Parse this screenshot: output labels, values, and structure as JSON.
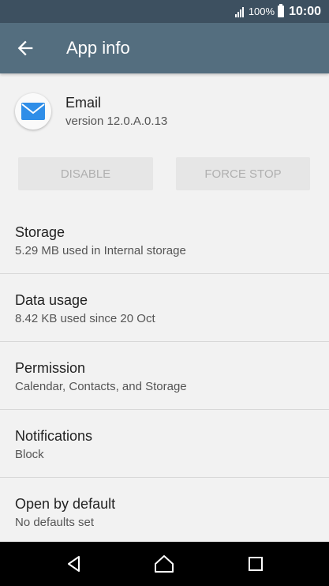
{
  "status_bar": {
    "battery_percent": "100%",
    "time": "10:00",
    "icons": [
      "signal-icon",
      "battery-icon"
    ]
  },
  "app_bar": {
    "back_icon": "arrow-back-icon",
    "title": "App info"
  },
  "app": {
    "icon": "mail-envelope-icon",
    "name": "Email",
    "version": "version 12.0.A.0.13"
  },
  "buttons": {
    "disable_label": "DISABLE",
    "force_stop_label": "FORCE STOP"
  },
  "settings": [
    {
      "title": "Storage",
      "subtitle": "5.29 MB used in Internal storage"
    },
    {
      "title": "Data usage",
      "subtitle": "8.42 KB used since 20 Oct"
    },
    {
      "title": "Permission",
      "subtitle": "Calendar, Contacts, and Storage"
    },
    {
      "title": "Notifications",
      "subtitle": "Block"
    },
    {
      "title": "Open by default",
      "subtitle": "No defaults set"
    }
  ],
  "nav_bar": {
    "icons": [
      "nav-back-icon",
      "nav-home-icon",
      "nav-recents-icon"
    ]
  },
  "colors": {
    "status_bar": "#3d5060",
    "app_bar": "#546e7f",
    "background": "#f2f2f2",
    "mail_icon": "#2f8ee8"
  }
}
